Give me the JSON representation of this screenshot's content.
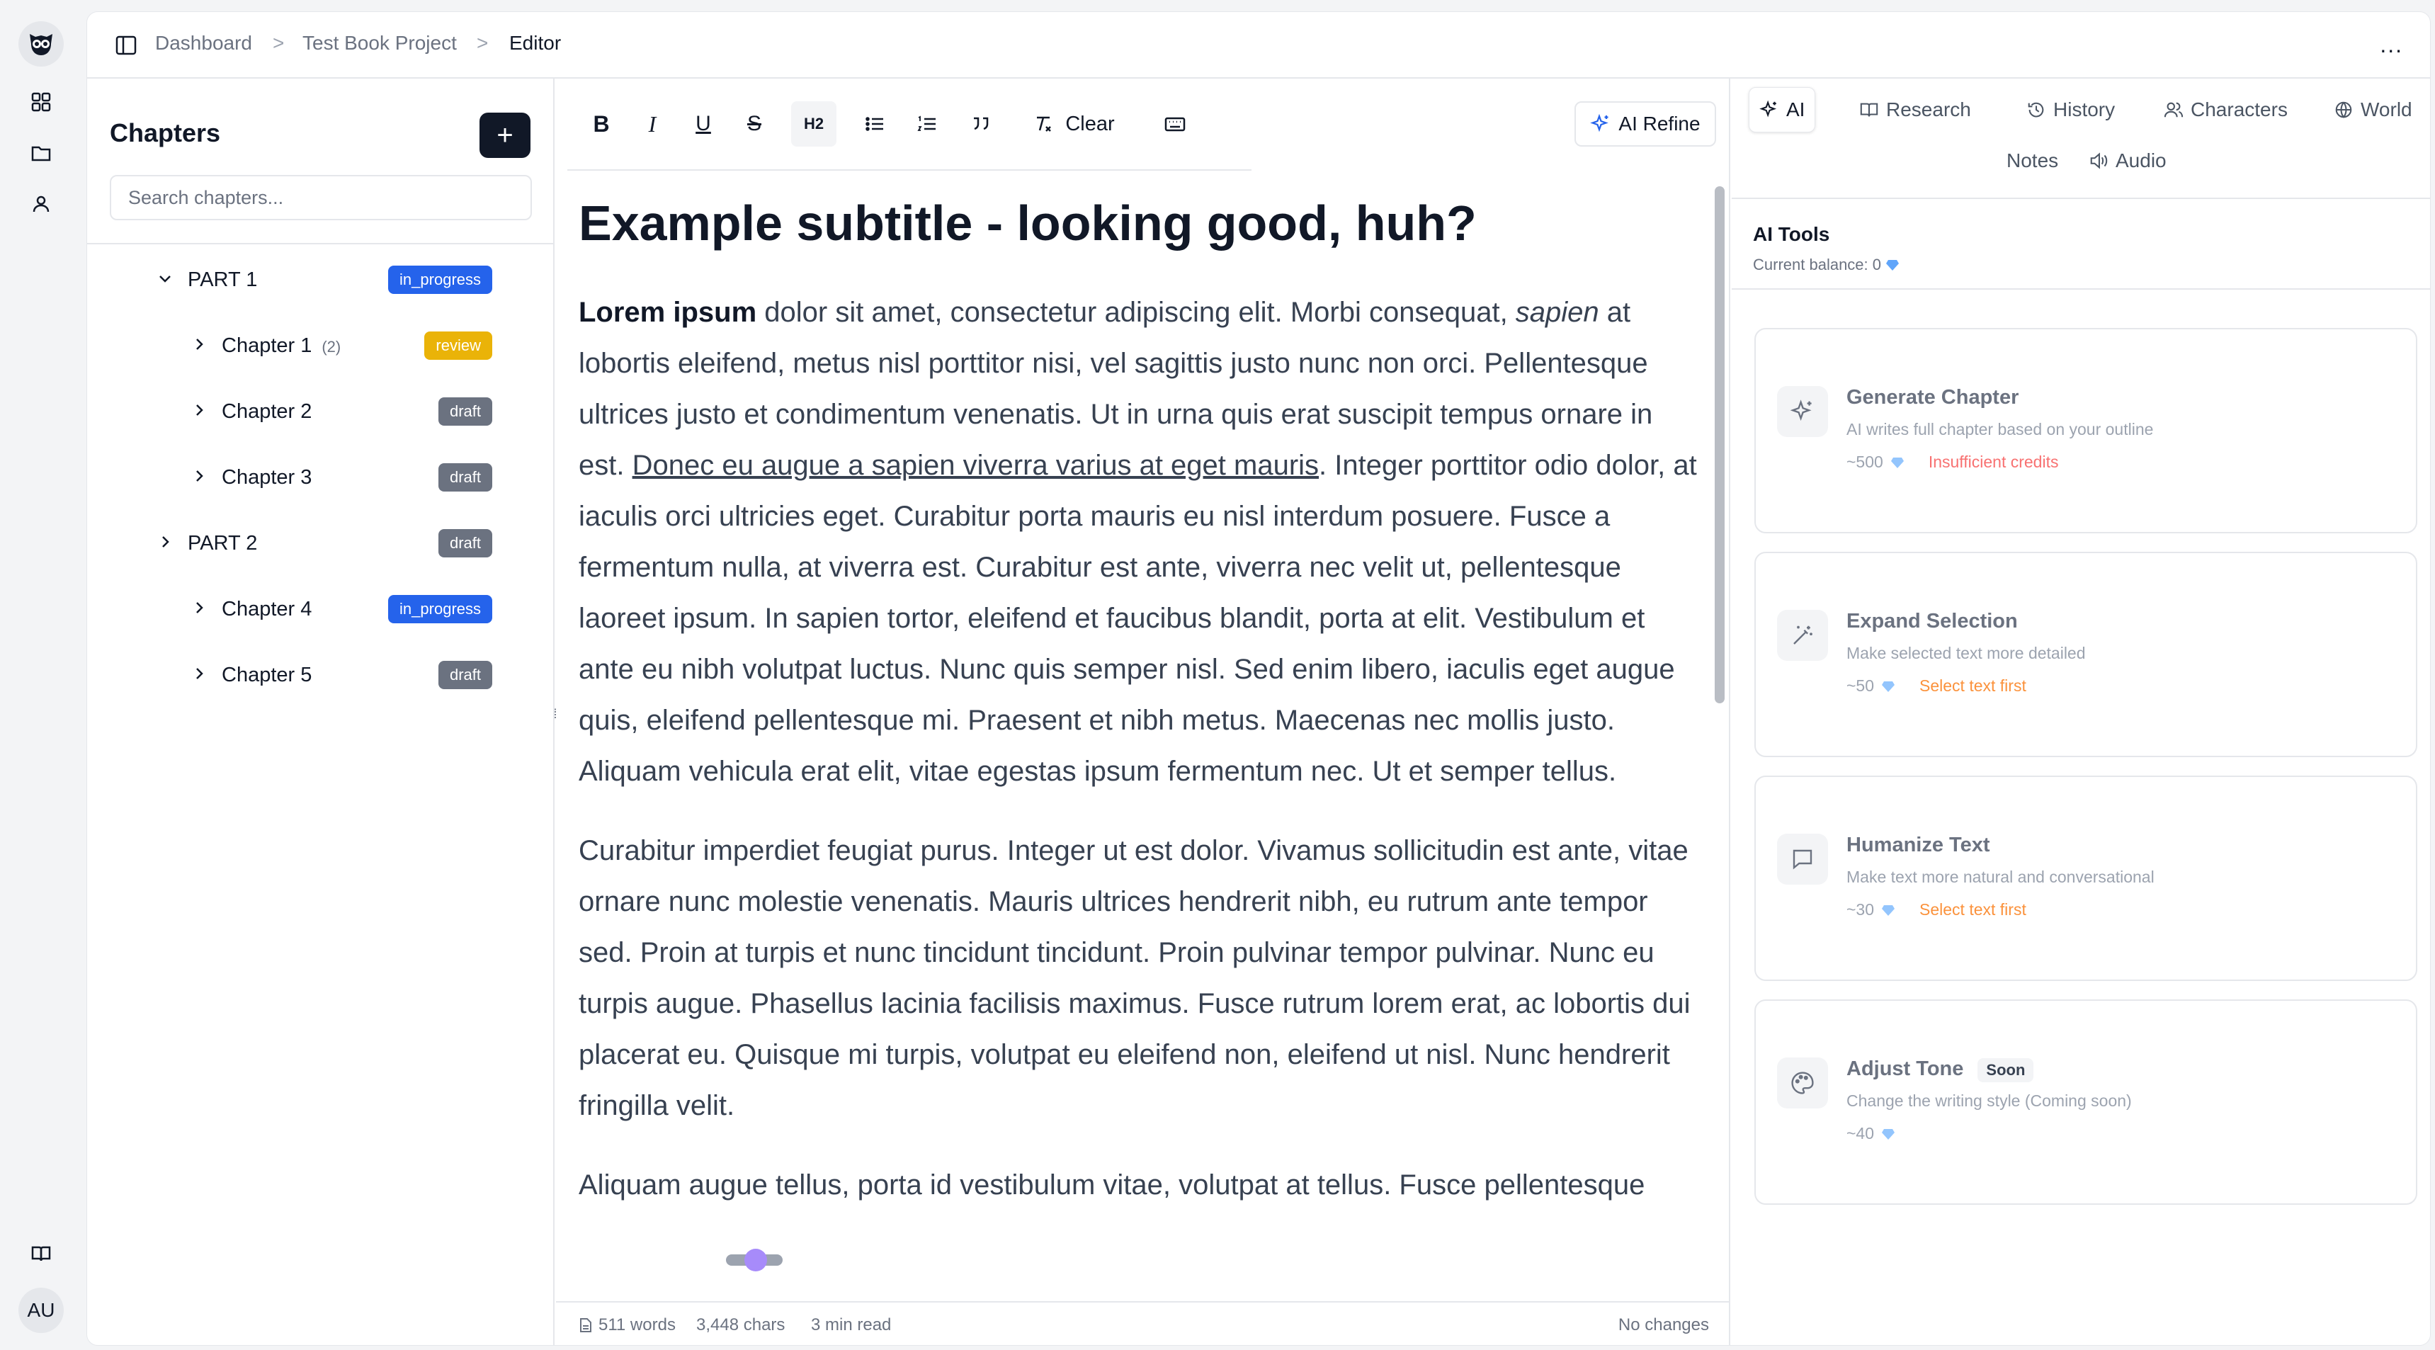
{
  "colors": {
    "accent": "#2563eb",
    "badge_in_progress": "#2563eb",
    "badge_review": "#eab308",
    "badge_draft": "#6b7280",
    "error": "#ef4444",
    "warning": "#f59e0b"
  },
  "rail": {
    "logo_icon": "owl-logo-icon",
    "items": [
      "dashboard-grid-icon",
      "folder-icon",
      "user-icon"
    ],
    "bottom_icon": "book-open-icon",
    "avatar": "AU"
  },
  "breadcrumb": {
    "items": [
      "Dashboard",
      "Test Book Project",
      "Editor"
    ],
    "separator": ">"
  },
  "more_label": "...",
  "chapters": {
    "title": "Chapters",
    "add_label": "+",
    "search_placeholder": "Search chapters...",
    "tree": [
      {
        "label": "PART 1",
        "status": "in_progress",
        "expanded": true,
        "level": 0
      },
      {
        "label": "Chapter 1",
        "count": "(2)",
        "status": "review",
        "level": 1
      },
      {
        "label": "Chapter 2",
        "status": "draft",
        "level": 1
      },
      {
        "label": "Chapter 3",
        "status": "draft",
        "level": 1
      },
      {
        "label": "PART 2",
        "status": "draft",
        "expanded": false,
        "level": 0
      },
      {
        "label": "Chapter 4",
        "status": "in_progress",
        "level": 1
      },
      {
        "label": "Chapter 5",
        "status": "draft",
        "level": 1
      }
    ]
  },
  "toolbar": {
    "bold": "B",
    "italic": "I",
    "underline": "U",
    "strike": "S",
    "heading": "H2",
    "clear": "Clear",
    "ai_refine": "AI Refine"
  },
  "document": {
    "heading": "Example subtitle - looking good, huh?",
    "p1_bold": "Lorem ipsum",
    "p1_a": " dolor sit amet, consectetur adipiscing elit. Morbi consequat, ",
    "p1_italic": "sapien",
    "p1_b": " at lobortis eleifend, metus nisl porttitor nisi, vel sagittis justo nunc non orci. Pellentesque ultrices justo et condimentum venenatis. Ut in urna quis erat suscipit tempus ornare in est. ",
    "p1_underline": "Donec eu augue a sapien viverra varius at eget mauris",
    "p1_c": ". Integer porttitor odio dolor, at iaculis orci ultricies eget. Curabitur porta mauris eu nisl interdum posuere. Fusce a fermentum nulla, at viverra est. Curabitur est ante, viverra nec velit ut, pellentesque laoreet ipsum. In sapien tortor, eleifend et faucibus blandit, porta at elit. Vestibulum et ante eu nibh volutpat luctus. Nunc quis semper nisl. Sed enim libero, iaculis eget augue quis, eleifend pellentesque mi. Praesent et nibh metus. Maecenas nec mollis justo. Aliquam vehicula erat elit, vitae egestas ipsum fermentum nec. Ut et semper tellus.",
    "p2": "Curabitur imperdiet feugiat purus. Integer ut est dolor. Vivamus sollicitudin est ante, vitae ornare nunc molestie venenatis. Mauris ultrices hendrerit nibh, eu rutrum ante tempor sed. Proin at turpis et nunc tincidunt tincidunt. Proin pulvinar tempor pulvinar. Nunc eu turpis augue. Phasellus lacinia facilisis maximus. Fusce rutrum lorem erat, ac lobortis dui placerat eu. Quisque mi turpis, volutpat eu eleifend non, eleifend ut nisl. Nunc hendrerit fringilla velit.",
    "p3": "Aliquam augue tellus, porta id vestibulum vitae, volutpat at tellus. Fusce pellentesque"
  },
  "status": {
    "words": "511 words",
    "chars": "3,448 chars",
    "read": "3 min read",
    "changes": "No changes"
  },
  "right_tabs": [
    {
      "label": "AI",
      "icon": "sparkles-icon",
      "active": true
    },
    {
      "label": "Research",
      "icon": "book-icon"
    },
    {
      "label": "History",
      "icon": "history-icon"
    },
    {
      "label": "Characters",
      "icon": "users-icon"
    },
    {
      "label": "World",
      "icon": "globe-icon"
    },
    {
      "label": "Notes",
      "icon": ""
    },
    {
      "label": "Audio",
      "icon": "speaker-icon"
    }
  ],
  "ai_tools": {
    "title": "AI Tools",
    "balance_label": "Current balance: 0",
    "tools": [
      {
        "title": "Generate Chapter",
        "desc": "AI writes full chapter based on your outline",
        "cost": "~500",
        "note": "Insufficient credits",
        "note_type": "error",
        "icon": "sparkles-icon"
      },
      {
        "title": "Expand Selection",
        "desc": "Make selected text more detailed",
        "cost": "~50",
        "note": "Select text first",
        "note_type": "warning",
        "icon": "magic-wand-icon"
      },
      {
        "title": "Humanize Text",
        "desc": "Make text more natural and conversational",
        "cost": "~30",
        "note": "Select text first",
        "note_type": "warning",
        "icon": "message-square-icon"
      },
      {
        "title": "Adjust Tone",
        "soon": "Soon",
        "desc": "Change the writing style (Coming soon)",
        "cost": "~40",
        "note": "",
        "icon": "palette-icon"
      }
    ]
  }
}
